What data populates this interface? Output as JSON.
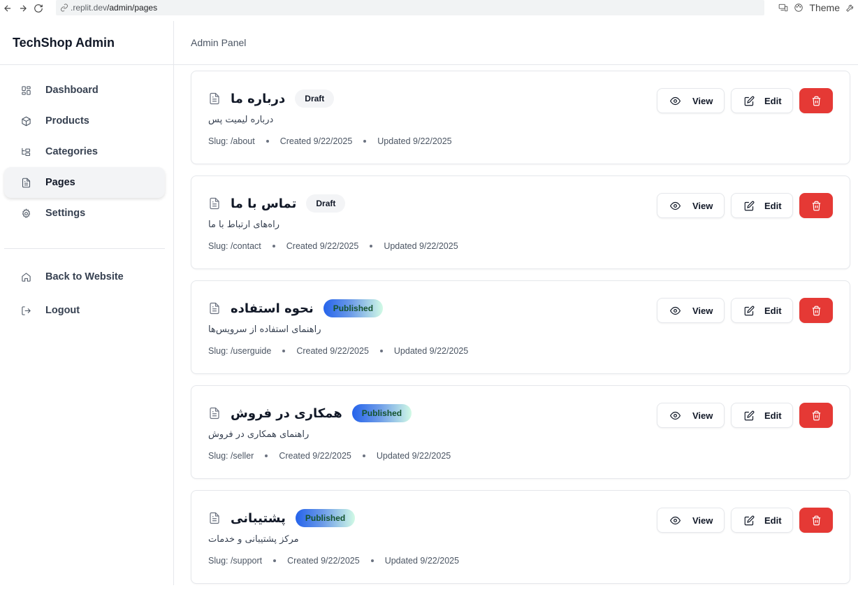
{
  "browser": {
    "url_host": ".replit.dev",
    "url_path": "/admin/pages",
    "theme_label": "Theme"
  },
  "sidebar": {
    "brand": "TechShop Admin",
    "items": [
      {
        "label": "Dashboard",
        "icon": "dashboard-icon"
      },
      {
        "label": "Products",
        "icon": "package-icon"
      },
      {
        "label": "Categories",
        "icon": "folder-tree-icon"
      },
      {
        "label": "Pages",
        "icon": "document-icon",
        "active": true
      },
      {
        "label": "Settings",
        "icon": "gear-icon"
      }
    ],
    "bottom_items": [
      {
        "label": "Back to Website",
        "icon": "home-icon"
      },
      {
        "label": "Logout",
        "icon": "logout-icon"
      }
    ]
  },
  "header": {
    "title": "Admin Panel"
  },
  "pages": [
    {
      "title": "درباره ما",
      "status": "Draft",
      "description": "درباره لیمیت پس",
      "slug": "Slug: /about",
      "created": "Created 9/22/2025",
      "updated": "Updated 9/22/2025"
    },
    {
      "title": "تماس با ما",
      "status": "Draft",
      "description": "راه‌های ارتباط با ما",
      "slug": "Slug: /contact",
      "created": "Created 9/22/2025",
      "updated": "Updated 9/22/2025"
    },
    {
      "title": "نحوه استفاده",
      "status": "Published",
      "description": "راهنمای استفاده از سرویس‌ها",
      "slug": "Slug: /userguide",
      "created": "Created 9/22/2025",
      "updated": "Updated 9/22/2025"
    },
    {
      "title": "همکاری در فروش",
      "status": "Published",
      "description": "راهنمای همکاری در فروش",
      "slug": "Slug: /seller",
      "created": "Created 9/22/2025",
      "updated": "Updated 9/22/2025"
    },
    {
      "title": "پشتیبانی",
      "status": "Published",
      "description": "مرکز پشتیبانی و خدمات",
      "slug": "Slug: /support",
      "created": "Created 9/22/2025",
      "updated": "Updated 9/22/2025"
    }
  ],
  "actions": {
    "view_label": "View",
    "edit_label": "Edit"
  },
  "colors": {
    "delete": "#e53935",
    "accent": "#2563eb"
  }
}
